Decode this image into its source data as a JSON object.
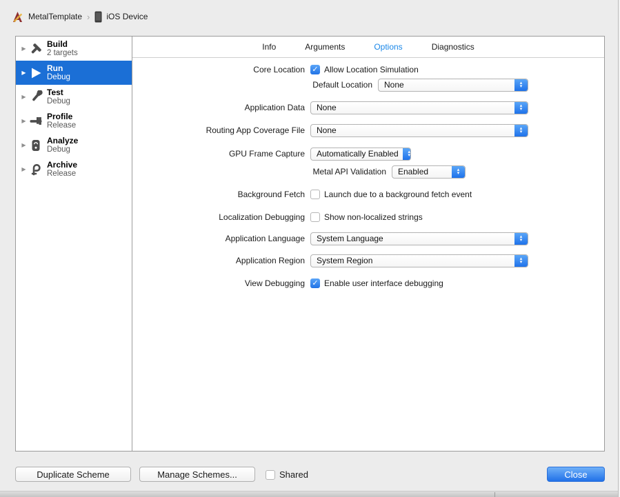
{
  "breadcrumb": {
    "project": "MetalTemplate",
    "destination": "iOS Device"
  },
  "sidebar": {
    "items": [
      {
        "title": "Build",
        "subtitle": "2 targets",
        "selected": false
      },
      {
        "title": "Run",
        "subtitle": "Debug",
        "selected": true
      },
      {
        "title": "Test",
        "subtitle": "Debug",
        "selected": false
      },
      {
        "title": "Profile",
        "subtitle": "Release",
        "selected": false
      },
      {
        "title": "Analyze",
        "subtitle": "Debug",
        "selected": false
      },
      {
        "title": "Archive",
        "subtitle": "Release",
        "selected": false
      }
    ]
  },
  "tabs": [
    {
      "label": "Info",
      "selected": false
    },
    {
      "label": "Arguments",
      "selected": false
    },
    {
      "label": "Options",
      "selected": true
    },
    {
      "label": "Diagnostics",
      "selected": false
    }
  ],
  "form": {
    "core_location": {
      "label": "Core Location",
      "checkbox_label": "Allow Location Simulation",
      "checked": true
    },
    "default_location": {
      "label": "Default Location",
      "value": "None"
    },
    "application_data": {
      "label": "Application Data",
      "value": "None"
    },
    "routing_app_coverage": {
      "label": "Routing App Coverage File",
      "value": "None"
    },
    "gpu_frame_capture": {
      "label": "GPU Frame Capture",
      "value": "Automatically Enabled"
    },
    "metal_api_validation": {
      "label": "Metal API Validation",
      "value": "Enabled"
    },
    "background_fetch": {
      "label": "Background Fetch",
      "checkbox_label": "Launch due to a background fetch event",
      "checked": false
    },
    "localization_debugging": {
      "label": "Localization Debugging",
      "checkbox_label": "Show non-localized strings",
      "checked": false
    },
    "application_language": {
      "label": "Application Language",
      "value": "System Language"
    },
    "application_region": {
      "label": "Application Region",
      "value": "System Region"
    },
    "view_debugging": {
      "label": "View Debugging",
      "checkbox_label": "Enable user interface debugging",
      "checked": true
    }
  },
  "footer": {
    "duplicate_label": "Duplicate Scheme",
    "manage_label": "Manage Schemes...",
    "shared_label": "Shared",
    "shared_checked": false,
    "close_label": "Close"
  },
  "colors": {
    "selection_blue": "#1b6fd6",
    "control_blue": "#2173e6",
    "active_tab_blue": "#1a87e8"
  }
}
